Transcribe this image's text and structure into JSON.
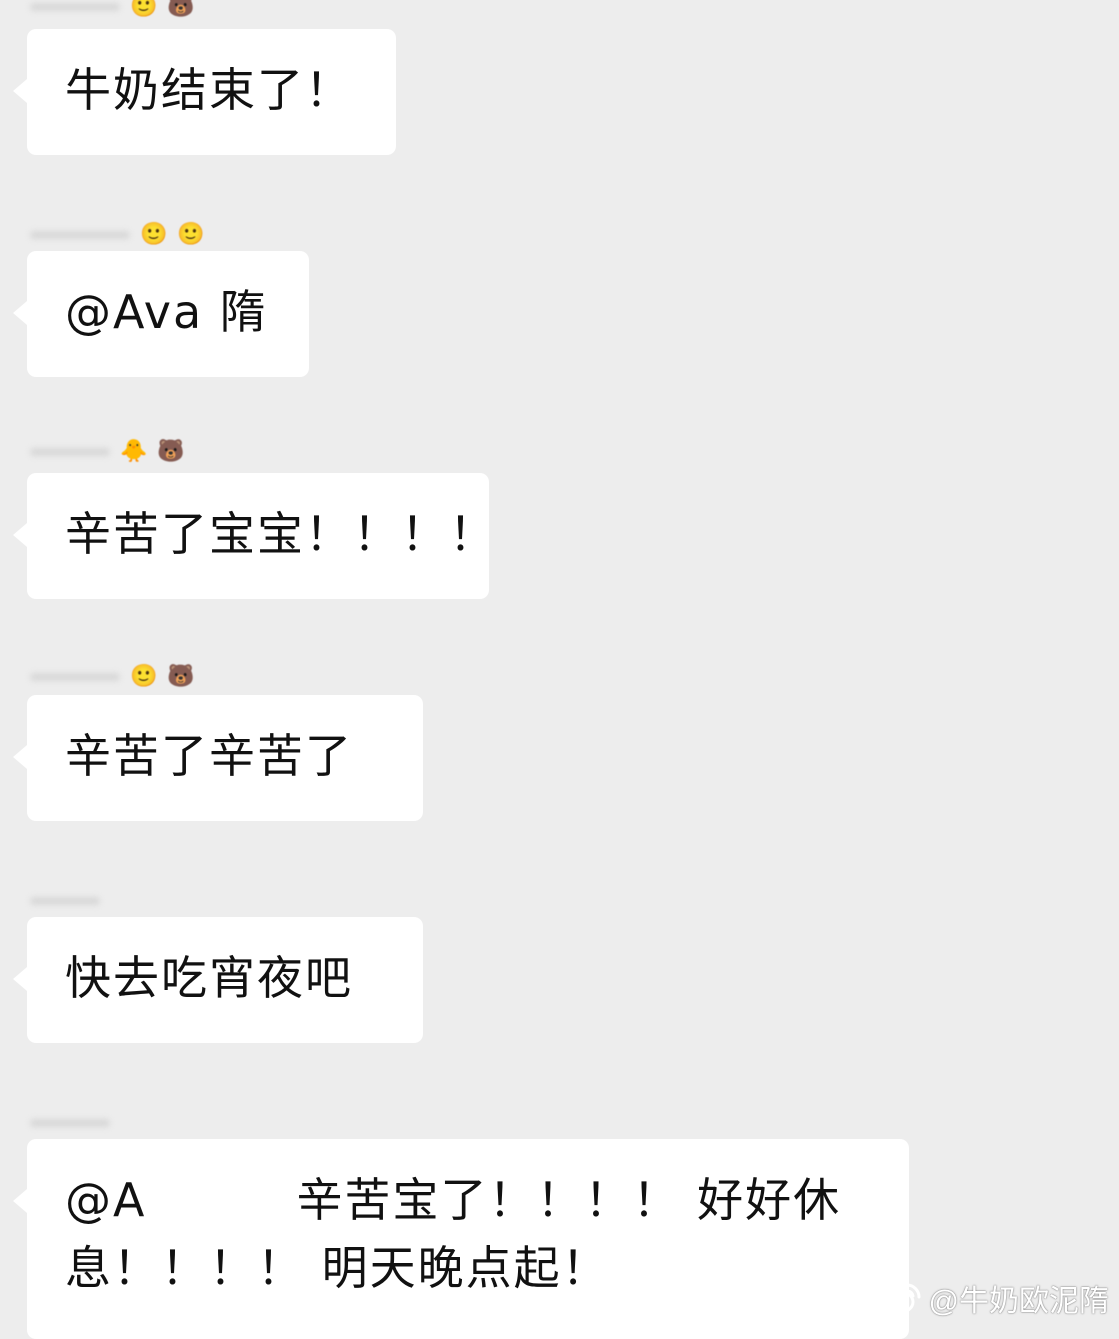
{
  "messages": [
    {
      "text": "牛奶结束了！",
      "emojis": [
        "🙂",
        "🐻"
      ]
    },
    {
      "text": "@Ava 隋",
      "emojis": [
        "🙂",
        "🙂"
      ]
    },
    {
      "text": "辛苦了宝宝！！！！",
      "emojis": [
        "🐥",
        "🐻"
      ]
    },
    {
      "text": "辛苦了辛苦了",
      "emojis": [
        "🙂",
        "🐻"
      ]
    },
    {
      "text": "快去吃宵夜吧",
      "emojis": []
    },
    {
      "text_prefix": "@A",
      "text_suffix": "辛苦宝了！！！！ 好好休息！！！！ 明天晚点起！",
      "emojis": []
    }
  ],
  "watermark": {
    "icon": "weibo-icon",
    "text": "@牛奶欧泥隋"
  },
  "colors": {
    "background": "#ededed",
    "bubble": "#ffffff",
    "text": "#111111"
  }
}
